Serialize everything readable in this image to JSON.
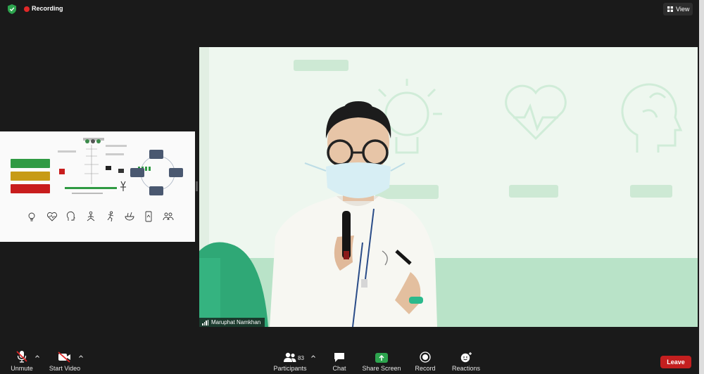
{
  "topbar": {
    "recording_label": "Recording",
    "view_label": "View",
    "colors": {
      "recording": "#e02828",
      "shield": "#2da44e"
    }
  },
  "slide": {
    "boxes": [
      "",
      "",
      ""
    ],
    "row_label": "",
    "icon_labels": [
      "",
      "",
      "",
      "",
      "",
      "",
      "",
      ""
    ]
  },
  "video": {
    "participant_name": "Maruphat Namkhan"
  },
  "toolbar": {
    "unmute_label": "Unmute",
    "start_video_label": "Start Video",
    "participants_label": "Participants",
    "participants_count": "83",
    "chat_label": "Chat",
    "share_screen_label": "Share Screen",
    "record_label": "Record",
    "reactions_label": "Reactions",
    "leave_label": "Leave",
    "colors": {
      "share": "#2da44e",
      "leave": "#c41f1f"
    }
  }
}
